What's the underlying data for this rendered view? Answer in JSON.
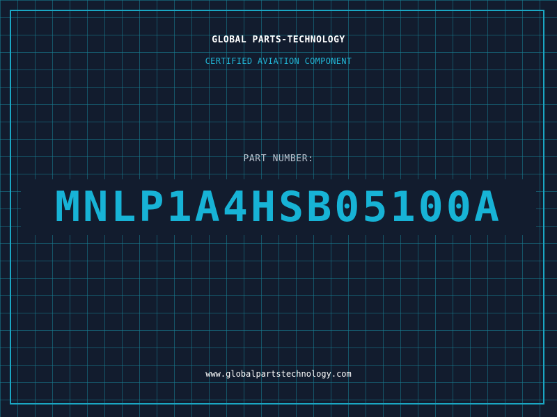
{
  "header": {
    "brand": "GLOBAL PARTS-TECHNOLOGY",
    "tagline": "CERTIFIED AVIATION COMPONENT"
  },
  "part": {
    "label": "PART NUMBER:",
    "number": "MNLP1A4HSB05100A"
  },
  "footer": {
    "url": "www.globalpartstechnology.com"
  },
  "colors": {
    "background": "#121c2e",
    "grid": "#1882a0",
    "accent": "#1aa7c4",
    "part_number": "#17b3d6",
    "text": "#ffffff",
    "label": "#b9c3cf"
  }
}
